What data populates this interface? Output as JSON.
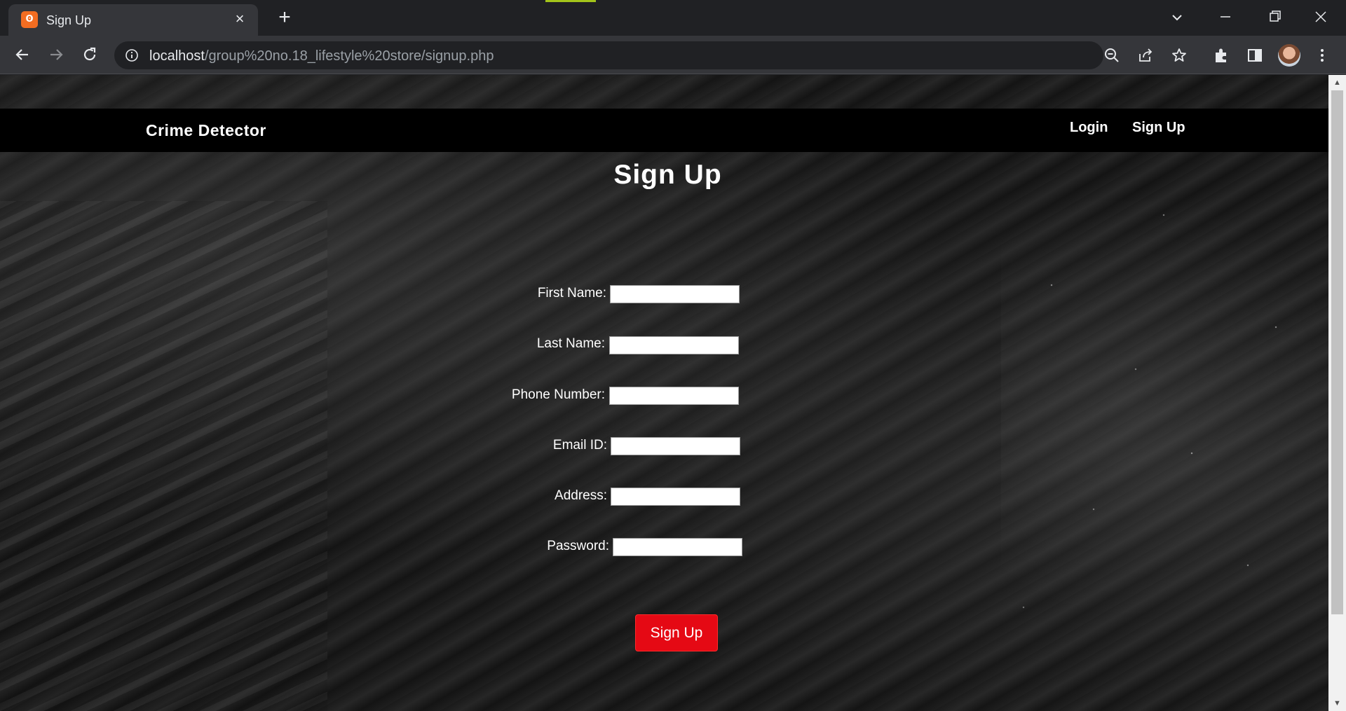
{
  "browser": {
    "tab_title": "Sign Up",
    "favicon_text": "ʘ",
    "url_host": "localhost",
    "url_path": "/group%20no.18_lifestyle%20store/signup.php",
    "icons": [
      "tab-search-icon",
      "minimize-icon",
      "restore-icon",
      "close-icon",
      "back-icon",
      "forward-icon",
      "reload-icon",
      "site-info-icon",
      "zoom-out-icon",
      "share-icon",
      "bookmark-star-icon",
      "extensions-icon",
      "side-panel-icon",
      "profile-avatar",
      "kebab-menu-icon"
    ],
    "accent_color": "#a3c41a"
  },
  "navbar": {
    "brand": "Crime Detector",
    "links": [
      "Login",
      "Sign Up"
    ]
  },
  "form": {
    "title": "Sign Up",
    "fields": [
      {
        "label": "First Name:",
        "value": ""
      },
      {
        "label": "Last Name:",
        "value": ""
      },
      {
        "label": "Phone Number:",
        "value": ""
      },
      {
        "label": "Email ID:",
        "value": ""
      },
      {
        "label": "Address:",
        "value": ""
      },
      {
        "label": "Password:",
        "value": ""
      }
    ],
    "submit_label": "Sign Up",
    "submit_color": "#e50914"
  }
}
